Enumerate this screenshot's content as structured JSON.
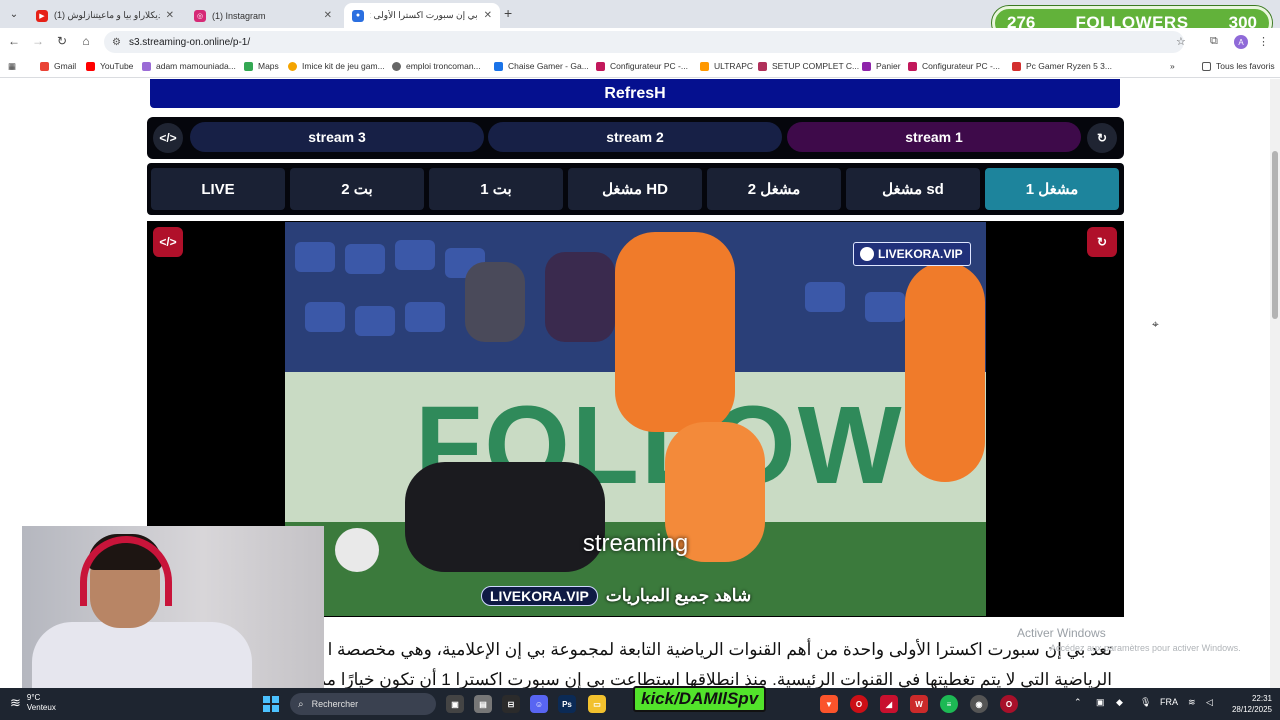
{
  "tabs": [
    {
      "title": "(1) ديكلاراو بيا و ماعيتنازلوش ... -",
      "active": false
    },
    {
      "title": "(1) Instagram",
      "active": false
    },
    {
      "title": "بي إن سبورت اكسترا الأولى :(",
      "active": true
    }
  ],
  "overlay": {
    "count_left": "276",
    "label": "FOLLOWERS",
    "count_right": "300"
  },
  "url": "s3.streaming-on.online/p-1/",
  "bookmarks": [
    "Gmail",
    "YouTube",
    "adam mamouniada...",
    "Maps",
    "Imice kit de jeu gam...",
    "emploi troncoman...",
    "Chaise Gamer - Ga...",
    "Configurateur PC -...",
    "ULTRAPC",
    "SETUP COMPLET C...",
    "Panier",
    "Configurateur PC -...",
    "Pc Gamer Ryzen 5 3...",
    "Tous les favoris"
  ],
  "page": {
    "refresh_label": "RefresH",
    "streams": [
      "stream 3",
      "stream 2",
      "stream 1"
    ],
    "players": [
      "LIVE",
      "بت 2",
      "بت 1",
      "مشغل HD",
      "مشغل 2",
      "مشغل sd",
      "مشغل 1"
    ],
    "code_icon": "</>",
    "video": {
      "logo": "LIVEKORA.VIP",
      "board_text": "FOLLOW",
      "caption": "streaming",
      "tag": "LIVEKORA.VIP",
      "tag_arabic": "شاهد جميع المباريات"
    },
    "description": [
      "تعد بي إن سبورت اكسترا الأولى واحدة من أهم القنوات الرياضية التابعة لمجموعة بي إن الإعلامية، وهي مخصصة ا",
      "الرياضية التي لا يتم تغطيتها في القنوات الرئيسية. منذ انطلاقها استطاعت بي إن سبورت اكسترا 1 أن تكون خيارًا مميزًا"
    ]
  },
  "windows_watermark": {
    "title": "Activer Windows",
    "subtitle": "Accédez aux paramètres pour activer Windows."
  },
  "taskbar": {
    "weather_temp": "9°C",
    "weather_desc": "Venteux",
    "search_placeholder": "Rechercher",
    "kick_label": "kick/DAMIlSpv",
    "lang": "FRA",
    "time": "22:31",
    "date": "28/12/2025"
  },
  "colors": {
    "refresh": "#05108f",
    "stream_active": "#3e0a4a",
    "player_active": "#1d849c",
    "red_control": "#b0102a",
    "followers": "#62b23a"
  }
}
